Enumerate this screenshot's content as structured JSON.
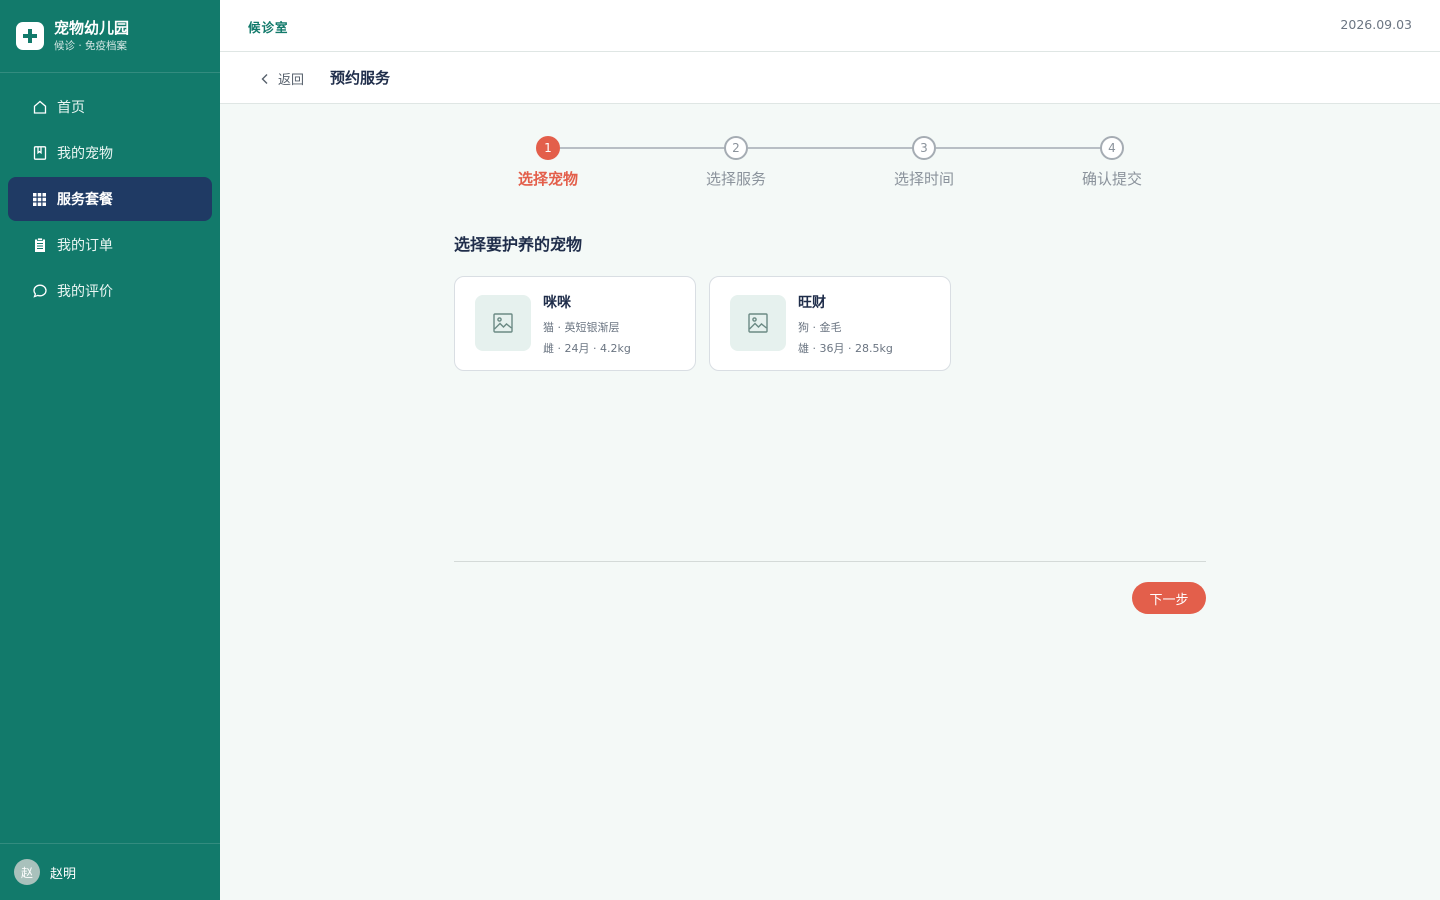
{
  "brand": {
    "name": "宠物幼儿园",
    "subtitle": "候诊 · 免疫档案",
    "logo_icon": "plus-cross-icon"
  },
  "sidebar": {
    "items": [
      {
        "label": "首页",
        "icon": "home-icon",
        "active": false
      },
      {
        "label": "我的宠物",
        "icon": "book-icon",
        "active": false
      },
      {
        "label": "服务套餐",
        "icon": "grid-icon",
        "active": true
      },
      {
        "label": "我的订单",
        "icon": "clipboard-icon",
        "active": false
      },
      {
        "label": "我的评价",
        "icon": "chat-bubble-icon",
        "active": false
      }
    ],
    "user": {
      "avatar_text": "赵",
      "name": "赵明"
    }
  },
  "topbar": {
    "title": "候诊室",
    "date": "2026.09.03"
  },
  "subheader": {
    "back_label": "返回",
    "page_title": "预约服务"
  },
  "steps": [
    {
      "number": "1",
      "label": "选择宠物",
      "active": true
    },
    {
      "number": "2",
      "label": "选择服务",
      "active": false
    },
    {
      "number": "3",
      "label": "选择时间",
      "active": false
    },
    {
      "number": "4",
      "label": "确认提交",
      "active": false
    }
  ],
  "main": {
    "section_title": "选择要护养的宠物",
    "pets": [
      {
        "name": "咪咪",
        "breed": "猫 · 英短银渐层",
        "meta": "雌 · 24月 · 4.2kg",
        "icon": "image-placeholder-icon"
      },
      {
        "name": "旺财",
        "breed": "狗 · 金毛",
        "meta": "雄 · 36月 · 28.5kg",
        "icon": "image-placeholder-icon"
      }
    ],
    "next_label": "下一步"
  },
  "colors": {
    "sidebar_bg": "#127a6b",
    "nav_active_bg": "#1f3a64",
    "accent": "#e35f4b",
    "page_bg": "#f4f9f7"
  }
}
